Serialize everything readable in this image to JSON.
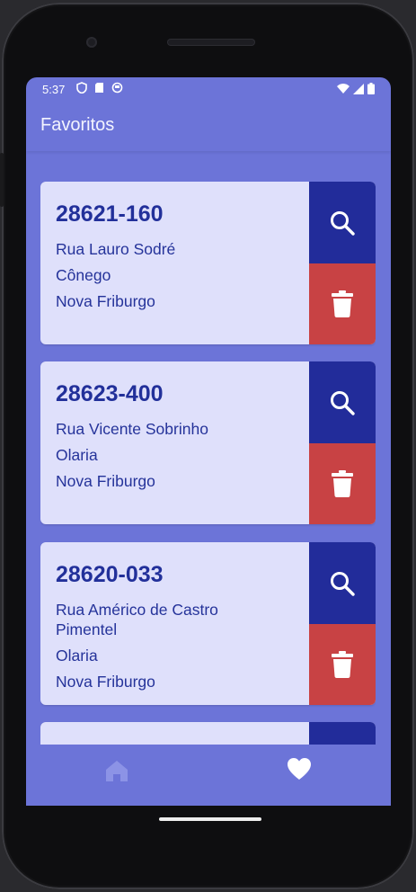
{
  "status": {
    "time": "5:37"
  },
  "appbar": {
    "title": "Favoritos"
  },
  "favorites": [
    {
      "cep": "28621-160",
      "street": "Rua Lauro Sodré",
      "neighborhood": "Cônego",
      "city": "Nova Friburgo"
    },
    {
      "cep": "28623-400",
      "street": "Rua Vicente Sobrinho",
      "neighborhood": "Olaria",
      "city": "Nova Friburgo"
    },
    {
      "cep": "28620-033",
      "street": "Rua Américo de Castro Pimentel",
      "neighborhood": "Olaria",
      "city": "Nova Friburgo"
    }
  ],
  "icons": {
    "search": "search-icon",
    "delete": "trash-icon",
    "nav_home": "home-icon",
    "nav_favorites": "heart-icon"
  },
  "colors": {
    "background": "#6c74d8",
    "card": "#dfe0fb",
    "primary": "#222c9a",
    "danger": "#c84244",
    "nav_inactive": "#8c93e6",
    "nav_active": "#ffffff"
  }
}
